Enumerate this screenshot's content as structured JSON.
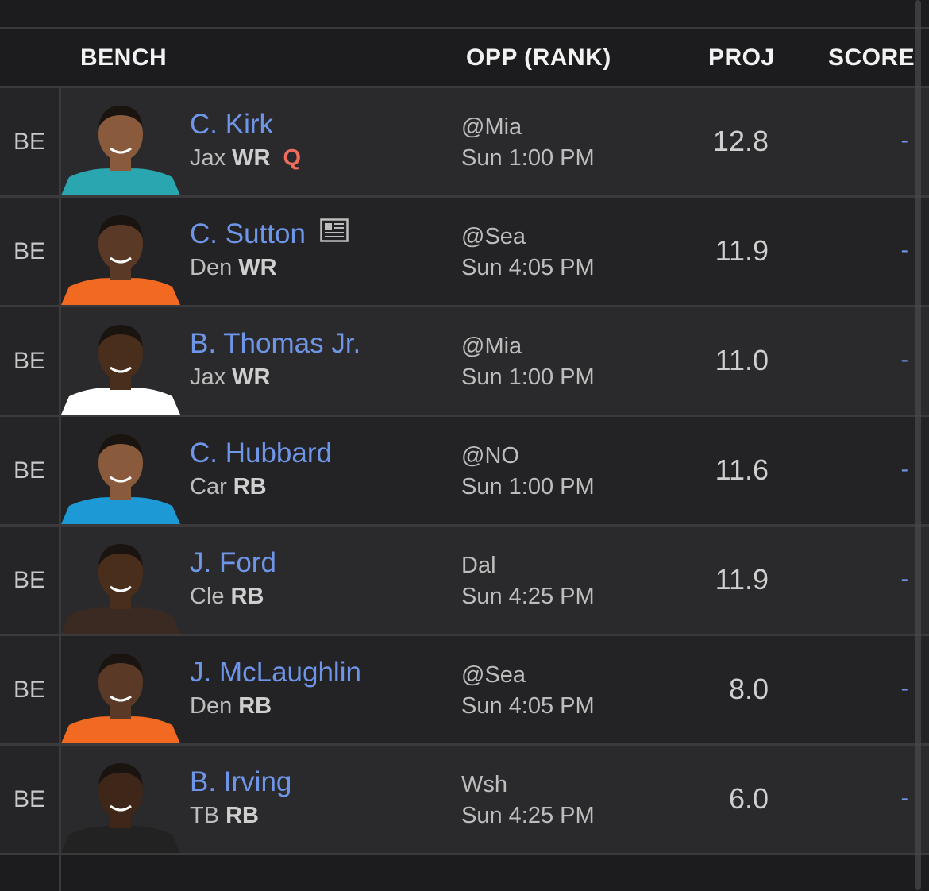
{
  "header": {
    "bench": "BENCH",
    "opp": "OPP (RANK)",
    "proj": "PROJ",
    "score": "SCORE"
  },
  "colors": {
    "background": "#1c1c1e",
    "row": "#2a2a2c",
    "link": "#6f95e8",
    "status_q": "#f06d5e"
  },
  "players": [
    {
      "slot": "BE",
      "name": "C. Kirk",
      "team": "Jax",
      "pos": "WR",
      "status": "Q",
      "news": false,
      "opp": "@Mia",
      "time": "Sun 1:00 PM",
      "proj": "12.8",
      "score": "-",
      "jersey": "#2aa6b0",
      "skin": "#8a5a3c"
    },
    {
      "slot": "BE",
      "name": "C. Sutton",
      "team": "Den",
      "pos": "WR",
      "status": "",
      "news": true,
      "opp": "@Sea",
      "time": "Sun 4:05 PM",
      "proj": "11.9",
      "score": "-",
      "jersey": "#f26a22",
      "skin": "#5a3a26"
    },
    {
      "slot": "BE",
      "name": "B. Thomas Jr.",
      "team": "Jax",
      "pos": "WR",
      "status": "",
      "news": false,
      "opp": "@Mia",
      "time": "Sun 1:00 PM",
      "proj": "11.0",
      "score": "-",
      "jersey": "#ffffff",
      "skin": "#4a2e1c"
    },
    {
      "slot": "BE",
      "name": "C. Hubbard",
      "team": "Car",
      "pos": "RB",
      "status": "",
      "news": false,
      "opp": "@NO",
      "time": "Sun 1:00 PM",
      "proj": "11.6",
      "score": "-",
      "jersey": "#1d9ad6",
      "skin": "#8a5a3c"
    },
    {
      "slot": "BE",
      "name": "J. Ford",
      "team": "Cle",
      "pos": "RB",
      "status": "",
      "news": false,
      "opp": "Dal",
      "time": "Sun 4:25 PM",
      "proj": "11.9",
      "score": "-",
      "jersey": "#3a2a22",
      "skin": "#4a2e1c"
    },
    {
      "slot": "BE",
      "name": "J. McLaughlin",
      "team": "Den",
      "pos": "RB",
      "status": "",
      "news": false,
      "opp": "@Sea",
      "time": "Sun 4:05 PM",
      "proj": "8.0",
      "score": "-",
      "jersey": "#f26a22",
      "skin": "#5a3a26"
    },
    {
      "slot": "BE",
      "name": "B. Irving",
      "team": "TB",
      "pos": "RB",
      "status": "",
      "news": false,
      "opp": "Wsh",
      "time": "Sun 4:25 PM",
      "proj": "6.0",
      "score": "-",
      "jersey": "#222222",
      "skin": "#3e2618"
    }
  ]
}
